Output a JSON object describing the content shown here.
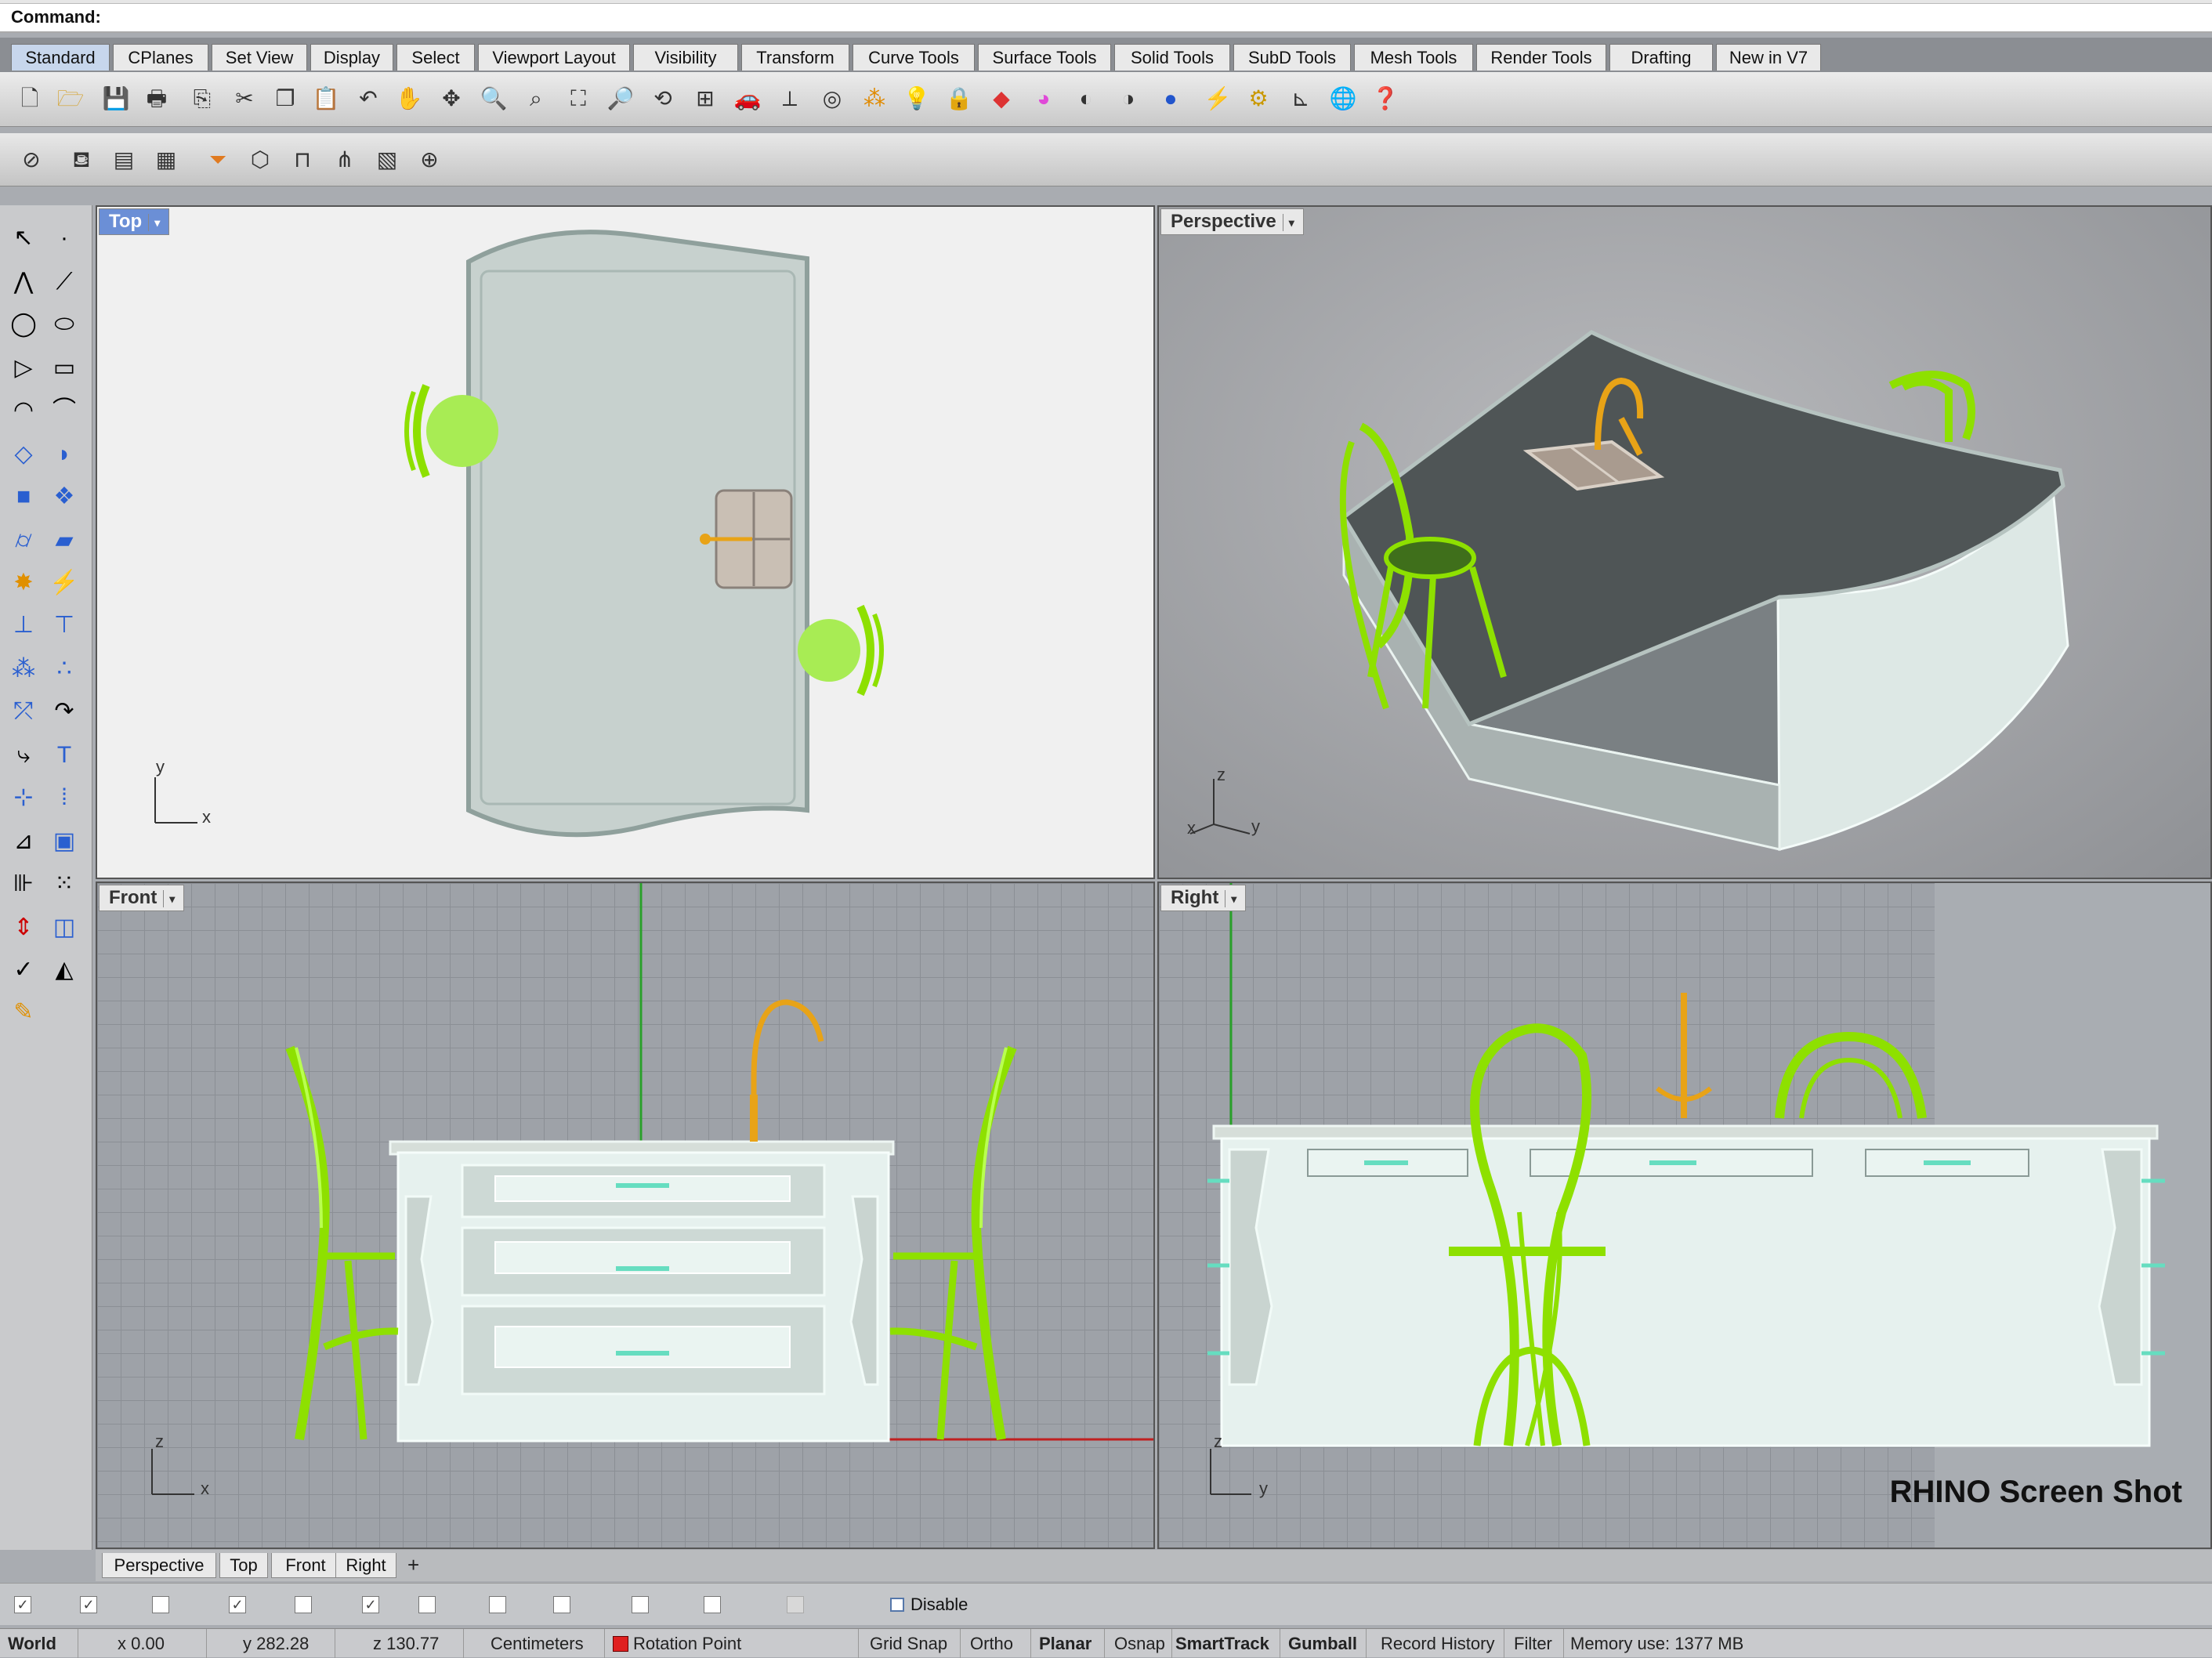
{
  "command": {
    "label": "Command:",
    "value": ""
  },
  "toolbar_tabs": [
    "Standard",
    "CPlanes",
    "Set View",
    "Display",
    "Select",
    "Viewport Layout",
    "Visibility",
    "Transform",
    "Curve Tools",
    "Surface Tools",
    "Solid Tools",
    "SubD Tools",
    "Mesh Tools",
    "Render Tools",
    "Drafting",
    "New in V7"
  ],
  "active_toolbar_tab": "Standard",
  "viewports": {
    "top": {
      "label": "Top",
      "axis_a": "y",
      "axis_b": "x"
    },
    "perspective": {
      "label": "Perspective",
      "axis_a": "z",
      "axis_b": "y",
      "axis_c": "x"
    },
    "front": {
      "label": "Front",
      "axis_a": "z",
      "axis_b": "x"
    },
    "right": {
      "label": "Right",
      "axis_a": "z",
      "axis_b": "y"
    }
  },
  "watermark": "RHINO Screen Shot",
  "viewport_tabs": [
    "Perspective",
    "Top",
    "Front",
    "Right"
  ],
  "add_tab": "+",
  "osnap_disable": "Disable",
  "status": {
    "cplane": "World",
    "x": "x 0.00",
    "y": "y 282.28",
    "z": "z 130.77",
    "units": "Centimeters",
    "layer": "Rotation Point",
    "grid_snap": "Grid Snap",
    "ortho": "Ortho",
    "planar": "Planar",
    "osnap": "Osnap",
    "smarttrack": "SmartTrack",
    "gumball": "Gumball",
    "record_history": "Record History",
    "filter": "Filter",
    "memory": "Memory use: 1377 MB"
  },
  "colors": {
    "accent": "#6b8fd6",
    "chair": "#8ee000",
    "faucet": "#e8a317",
    "cabinet": "#e9f4f0",
    "countertop": "#4f5556",
    "layer_swatch": "#e02020"
  }
}
